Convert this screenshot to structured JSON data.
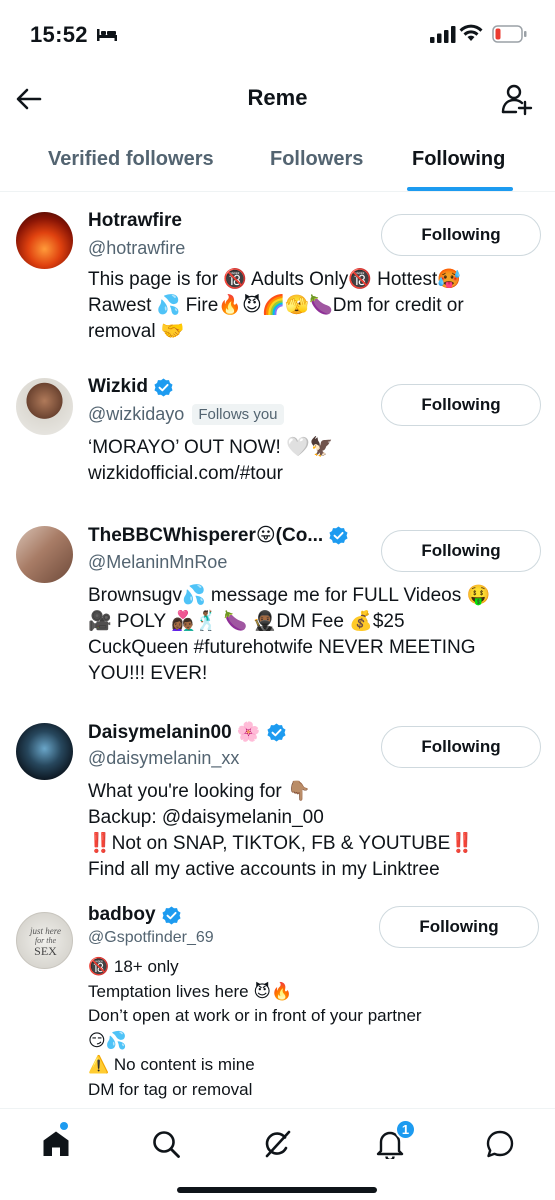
{
  "status_bar": {
    "time": "15:52"
  },
  "header": {
    "title": "Reme"
  },
  "tabs": [
    {
      "label": "Verified followers",
      "active": false
    },
    {
      "label": "Followers",
      "active": false
    },
    {
      "label": "Following",
      "active": true
    }
  ],
  "users": [
    {
      "name": "Hotrawfire",
      "handle": "@hotrawfire",
      "verified": false,
      "follows_you": "",
      "button": "Following",
      "bio": [
        "This page is for 🔞 Adults Only🔞 Hottest🥵",
        "Rawest 💦 Fire🔥😈🌈🫣🍆Dm for credit or",
        "removal 🤝"
      ]
    },
    {
      "name": "Wizkid",
      "handle": "@wizkidayo",
      "verified": true,
      "follows_you": "Follows you",
      "button": "Following",
      "bio": [
        "‘MORAYO’ OUT NOW! 🤍🦅",
        "wizkidofficial.com/#tour"
      ]
    },
    {
      "name": "TheBBCWhisperer😛(Co...",
      "handle": "@MelaninMnRoe",
      "verified": true,
      "follows_you": "",
      "button": "Following",
      "bio": [
        "Brownsugv💦 message me for FULL Videos 🤑",
        "🎥 POLY 👩🏾‍❤️‍👨🏾🕺🏾 🍆 🥷🏾DM Fee 💰$25",
        "CuckQueen #futurehotwife NEVER MEETING",
        "YOU!!! EVER!"
      ]
    },
    {
      "name": "Daisymelanin00 🌸",
      "handle": "@daisymelanin_xx",
      "verified": true,
      "follows_you": "",
      "button": "Following",
      "bio": [
        "What you're looking for 👇🏽",
        "Backup: @daisymelanin_00",
        "‼️Not on SNAP, TIKTOK, FB & YOUTUBE‼️",
        "Find all my active accounts in my Linktree"
      ]
    },
    {
      "name": "badboy",
      "handle": "@Gspotfinder_69",
      "verified": true,
      "follows_you": "",
      "button": "Following",
      "avatar_text": "just here for the SEX",
      "bio": [
        "🔞 18+ only",
        "Temptation lives here 😈🔥",
        "Don’t open at work or in front of your partner",
        "😏💦",
        "⚠️ No content is mine",
        "DM for tag or removal"
      ]
    }
  ],
  "bottom_nav": {
    "items": [
      "home-icon",
      "search-icon",
      "grok-icon",
      "notifications-icon",
      "messages-icon"
    ],
    "notification_count": "1"
  },
  "colors": {
    "accent": "#1d9bf0",
    "text": "#0f1419",
    "secondary": "#536471"
  }
}
